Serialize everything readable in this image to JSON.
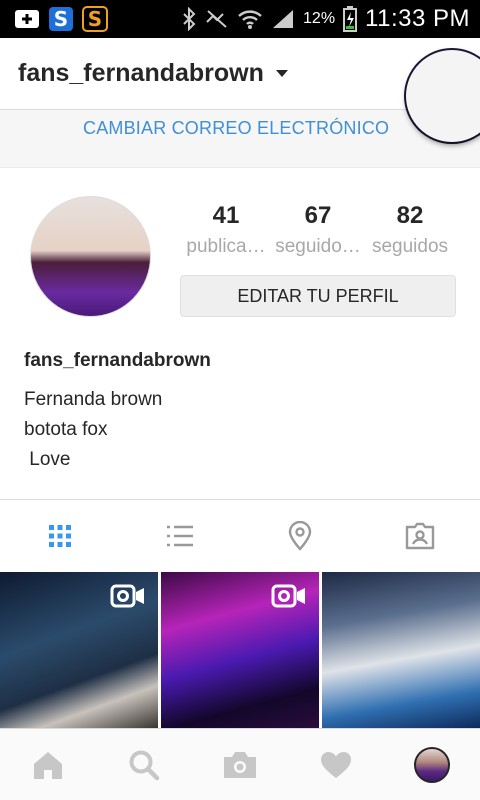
{
  "status_bar": {
    "battery_percent": "12%",
    "time": "11:33 PM"
  },
  "header": {
    "username": "fans_fernandabrown"
  },
  "change_email_link": "CAMBIAR CORREO ELECTRÓNICO",
  "profile": {
    "stats": [
      {
        "value": "41",
        "label": "publica…"
      },
      {
        "value": "67",
        "label": "seguido…"
      },
      {
        "value": "82",
        "label": "seguidos"
      }
    ],
    "edit_button": "EDITAR TU PERFIL",
    "bio_username": "fans_fernandabrown",
    "bio_lines": "Fernanda brown\nbotota fox\n Love"
  },
  "tabs": [
    {
      "icon": "grid-icon",
      "active": true
    },
    {
      "icon": "list-icon",
      "active": false
    },
    {
      "icon": "location-pin-icon",
      "active": false
    },
    {
      "icon": "tagged-photos-icon",
      "active": false
    }
  ],
  "grid_posts": [
    {
      "type": "video"
    },
    {
      "type": "video"
    },
    {
      "type": "photo"
    }
  ],
  "bottom_nav": [
    "home-icon",
    "search-icon",
    "camera-icon",
    "heart-icon",
    "profile-avatar"
  ],
  "colors": {
    "accent_blue": "#3f8fd6",
    "active_tab": "#3897f0",
    "inactive_icon": "#999999"
  }
}
